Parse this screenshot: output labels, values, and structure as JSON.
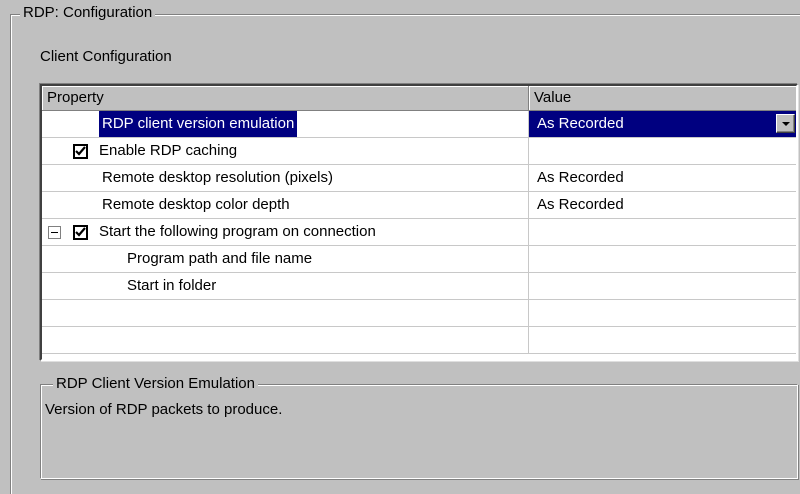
{
  "group_title": "RDP: Configuration",
  "section_label": "Client Configuration",
  "grid": {
    "headers": {
      "property": "Property",
      "value": "Value"
    },
    "rows": [
      {
        "property": "RDP client version emulation",
        "value": "As Recorded",
        "selected": true,
        "has_dropdown": true
      },
      {
        "property": "Enable RDP caching",
        "value": "",
        "checkbox": true,
        "checked": true
      },
      {
        "property": "Remote desktop resolution (pixels)",
        "value": "As Recorded"
      },
      {
        "property": "Remote desktop color depth",
        "value": "As Recorded"
      },
      {
        "property": "Start the following program on connection",
        "value": "",
        "checkbox": true,
        "checked": true,
        "expander": "collapse"
      },
      {
        "property": "Program path and file name",
        "value": ""
      },
      {
        "property": "Start in folder",
        "value": ""
      },
      {
        "property": "",
        "value": ""
      },
      {
        "property": "",
        "value": ""
      }
    ]
  },
  "description": {
    "title": "RDP Client Version Emulation",
    "text": "Version of RDP packets to produce."
  }
}
